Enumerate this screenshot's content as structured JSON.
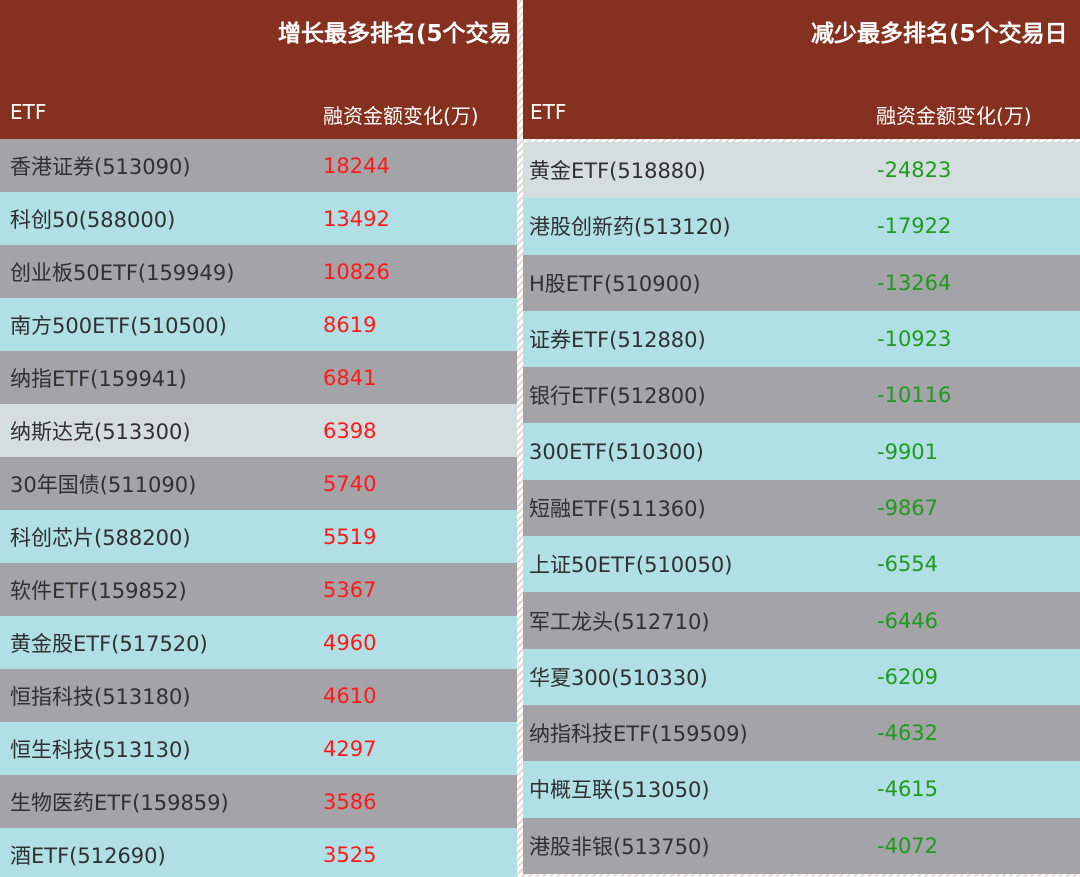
{
  "left": {
    "title": "增长最多排名(5个交易",
    "col_etf": "ETF",
    "col_change": "融资金额变化(万)",
    "rows": [
      {
        "name": "香港证券(513090)",
        "value": "18244",
        "shade": "gray"
      },
      {
        "name": "科创50(588000)",
        "value": "13492",
        "shade": "cyan"
      },
      {
        "name": "创业板50ETF(159949)",
        "value": "10826",
        "shade": "gray"
      },
      {
        "name": "南方500ETF(510500)",
        "value": "8619",
        "shade": "cyan"
      },
      {
        "name": "纳指ETF(159941)",
        "value": "6841",
        "shade": "gray"
      },
      {
        "name": "纳斯达克(513300)",
        "value": "6398",
        "shade": "pale"
      },
      {
        "name": "30年国债(511090)",
        "value": "5740",
        "shade": "gray"
      },
      {
        "name": "科创芯片(588200)",
        "value": "5519",
        "shade": "cyan"
      },
      {
        "name": "软件ETF(159852)",
        "value": "5367",
        "shade": "gray"
      },
      {
        "name": "黄金股ETF(517520)",
        "value": "4960",
        "shade": "cyan"
      },
      {
        "name": "恒指科技(513180)",
        "value": "4610",
        "shade": "gray"
      },
      {
        "name": "恒生科技(513130)",
        "value": "4297",
        "shade": "cyan"
      },
      {
        "name": "生物医药ETF(159859)",
        "value": "3586",
        "shade": "gray"
      },
      {
        "name": "酒ETF(512690)",
        "value": "3525",
        "shade": "cyan"
      }
    ]
  },
  "right": {
    "title": "减少最多排名(5个交易日",
    "col_etf": "ETF",
    "col_change": "融资金额变化(万)",
    "rows": [
      {
        "name": "黄金ETF(518880)",
        "value": "-24823",
        "shade": "pale"
      },
      {
        "name": "港股创新药(513120)",
        "value": "-17922",
        "shade": "cyan"
      },
      {
        "name": "H股ETF(510900)",
        "value": "-13264",
        "shade": "gray"
      },
      {
        "name": "证券ETF(512880)",
        "value": "-10923",
        "shade": "cyan"
      },
      {
        "name": "银行ETF(512800)",
        "value": "-10116",
        "shade": "gray"
      },
      {
        "name": "300ETF(510300)",
        "value": "-9901",
        "shade": "cyan"
      },
      {
        "name": "短融ETF(511360)",
        "value": "-9867",
        "shade": "gray"
      },
      {
        "name": "上证50ETF(510050)",
        "value": "-6554",
        "shade": "cyan"
      },
      {
        "name": "军工龙头(512710)",
        "value": "-6446",
        "shade": "gray"
      },
      {
        "name": "华夏300(510330)",
        "value": "-6209",
        "shade": "cyan"
      },
      {
        "name": "纳指科技ETF(159509)",
        "value": "-4632",
        "shade": "gray"
      },
      {
        "name": "中概互联(513050)",
        "value": "-4615",
        "shade": "cyan"
      },
      {
        "name": "港股非银(513750)",
        "value": "-4072",
        "shade": "gray"
      }
    ]
  },
  "colors": {
    "header_bg": "#86311f",
    "row_gray": "#a3a3a8",
    "row_cyan": "#b0dfe5",
    "row_pale": "#d5dede",
    "increase_text": "#ff1a1a",
    "decrease_text": "#1f9a1f"
  }
}
